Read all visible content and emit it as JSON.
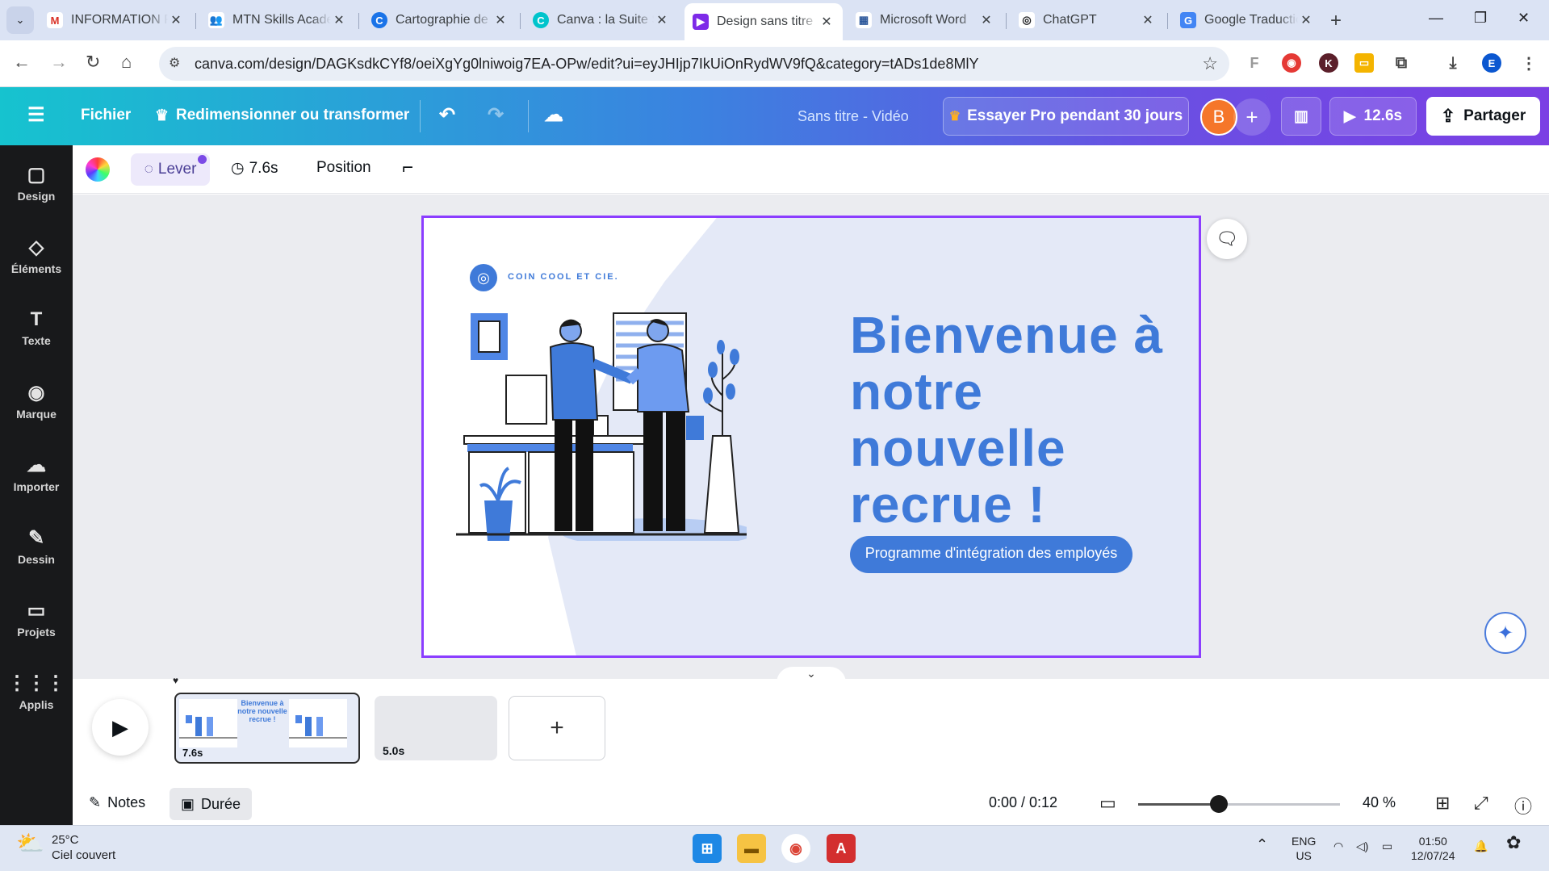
{
  "browser": {
    "tabs": [
      {
        "title": "INFORMATION P",
        "fav": "M",
        "color": "#d93025"
      },
      {
        "title": "MTN Skills Acade",
        "fav": "👥",
        "color": "#5f6368"
      },
      {
        "title": "Cartographie de",
        "fav": "C",
        "color": "#1a73e8"
      },
      {
        "title": "Canva : la Suite S",
        "fav": "C",
        "color": "#00c4cc"
      },
      {
        "title": "Design sans titre",
        "fav": "▶",
        "color": "#7d2ae8",
        "active": true
      },
      {
        "title": "Microsoft Word",
        "fav": "▦",
        "color": "#2b579a"
      },
      {
        "title": "ChatGPT",
        "fav": "◎",
        "color": "#202124"
      },
      {
        "title": "Google Traductio",
        "fav": "G",
        "color": "#4285f4"
      }
    ],
    "url": "canva.com/design/DAGKsdkCYf8/oeiXgYg0lniwoig7EA-OPw/edit?ui=eyJHIjp7IkUiOnRydWV9fQ&category=tADs1de8MlY",
    "profile_initial": "E"
  },
  "canva": {
    "menu_file": "Fichier",
    "resize": "Redimensionner ou transformer",
    "doc_name": "Sans titre - Vidéo",
    "pro_trial": "Essayer Pro pendant 30 jours",
    "avatar": "B",
    "play_duration": "12.6s",
    "share": "Partager",
    "sidebar": [
      {
        "label": "Design",
        "icon": "▢"
      },
      {
        "label": "Éléments",
        "icon": "◇"
      },
      {
        "label": "Texte",
        "icon": "T"
      },
      {
        "label": "Marque",
        "icon": "◉"
      },
      {
        "label": "Importer",
        "icon": "☁"
      },
      {
        "label": "Dessin",
        "icon": "✎"
      },
      {
        "label": "Projets",
        "icon": "▭"
      },
      {
        "label": "Applis",
        "icon": "⋮⋮⋮"
      }
    ],
    "toolbar": {
      "animate": "Lever",
      "duration": "7.6s",
      "position": "Position"
    },
    "slide": {
      "brand": "COIN COOL ET CIE.",
      "headline": "Bienvenue à notre nouvelle recrue !",
      "pill_text": "Programme d'intégration des employés"
    },
    "timeline": {
      "clip1_duration": "7.6s",
      "clip1_mini_text": "Bienvenue à notre nouvelle recrue !",
      "clip2_duration": "5.0s"
    },
    "footer": {
      "notes": "Notes",
      "duration": "Durée",
      "time": "0:00 / 0:12",
      "zoom": "40 %",
      "zoom_level": 0.4
    }
  },
  "taskbar": {
    "temp": "25°C",
    "weather": "Ciel couvert",
    "lang1": "ENG",
    "lang2": "US",
    "time": "01:50",
    "date": "12/07/24"
  }
}
